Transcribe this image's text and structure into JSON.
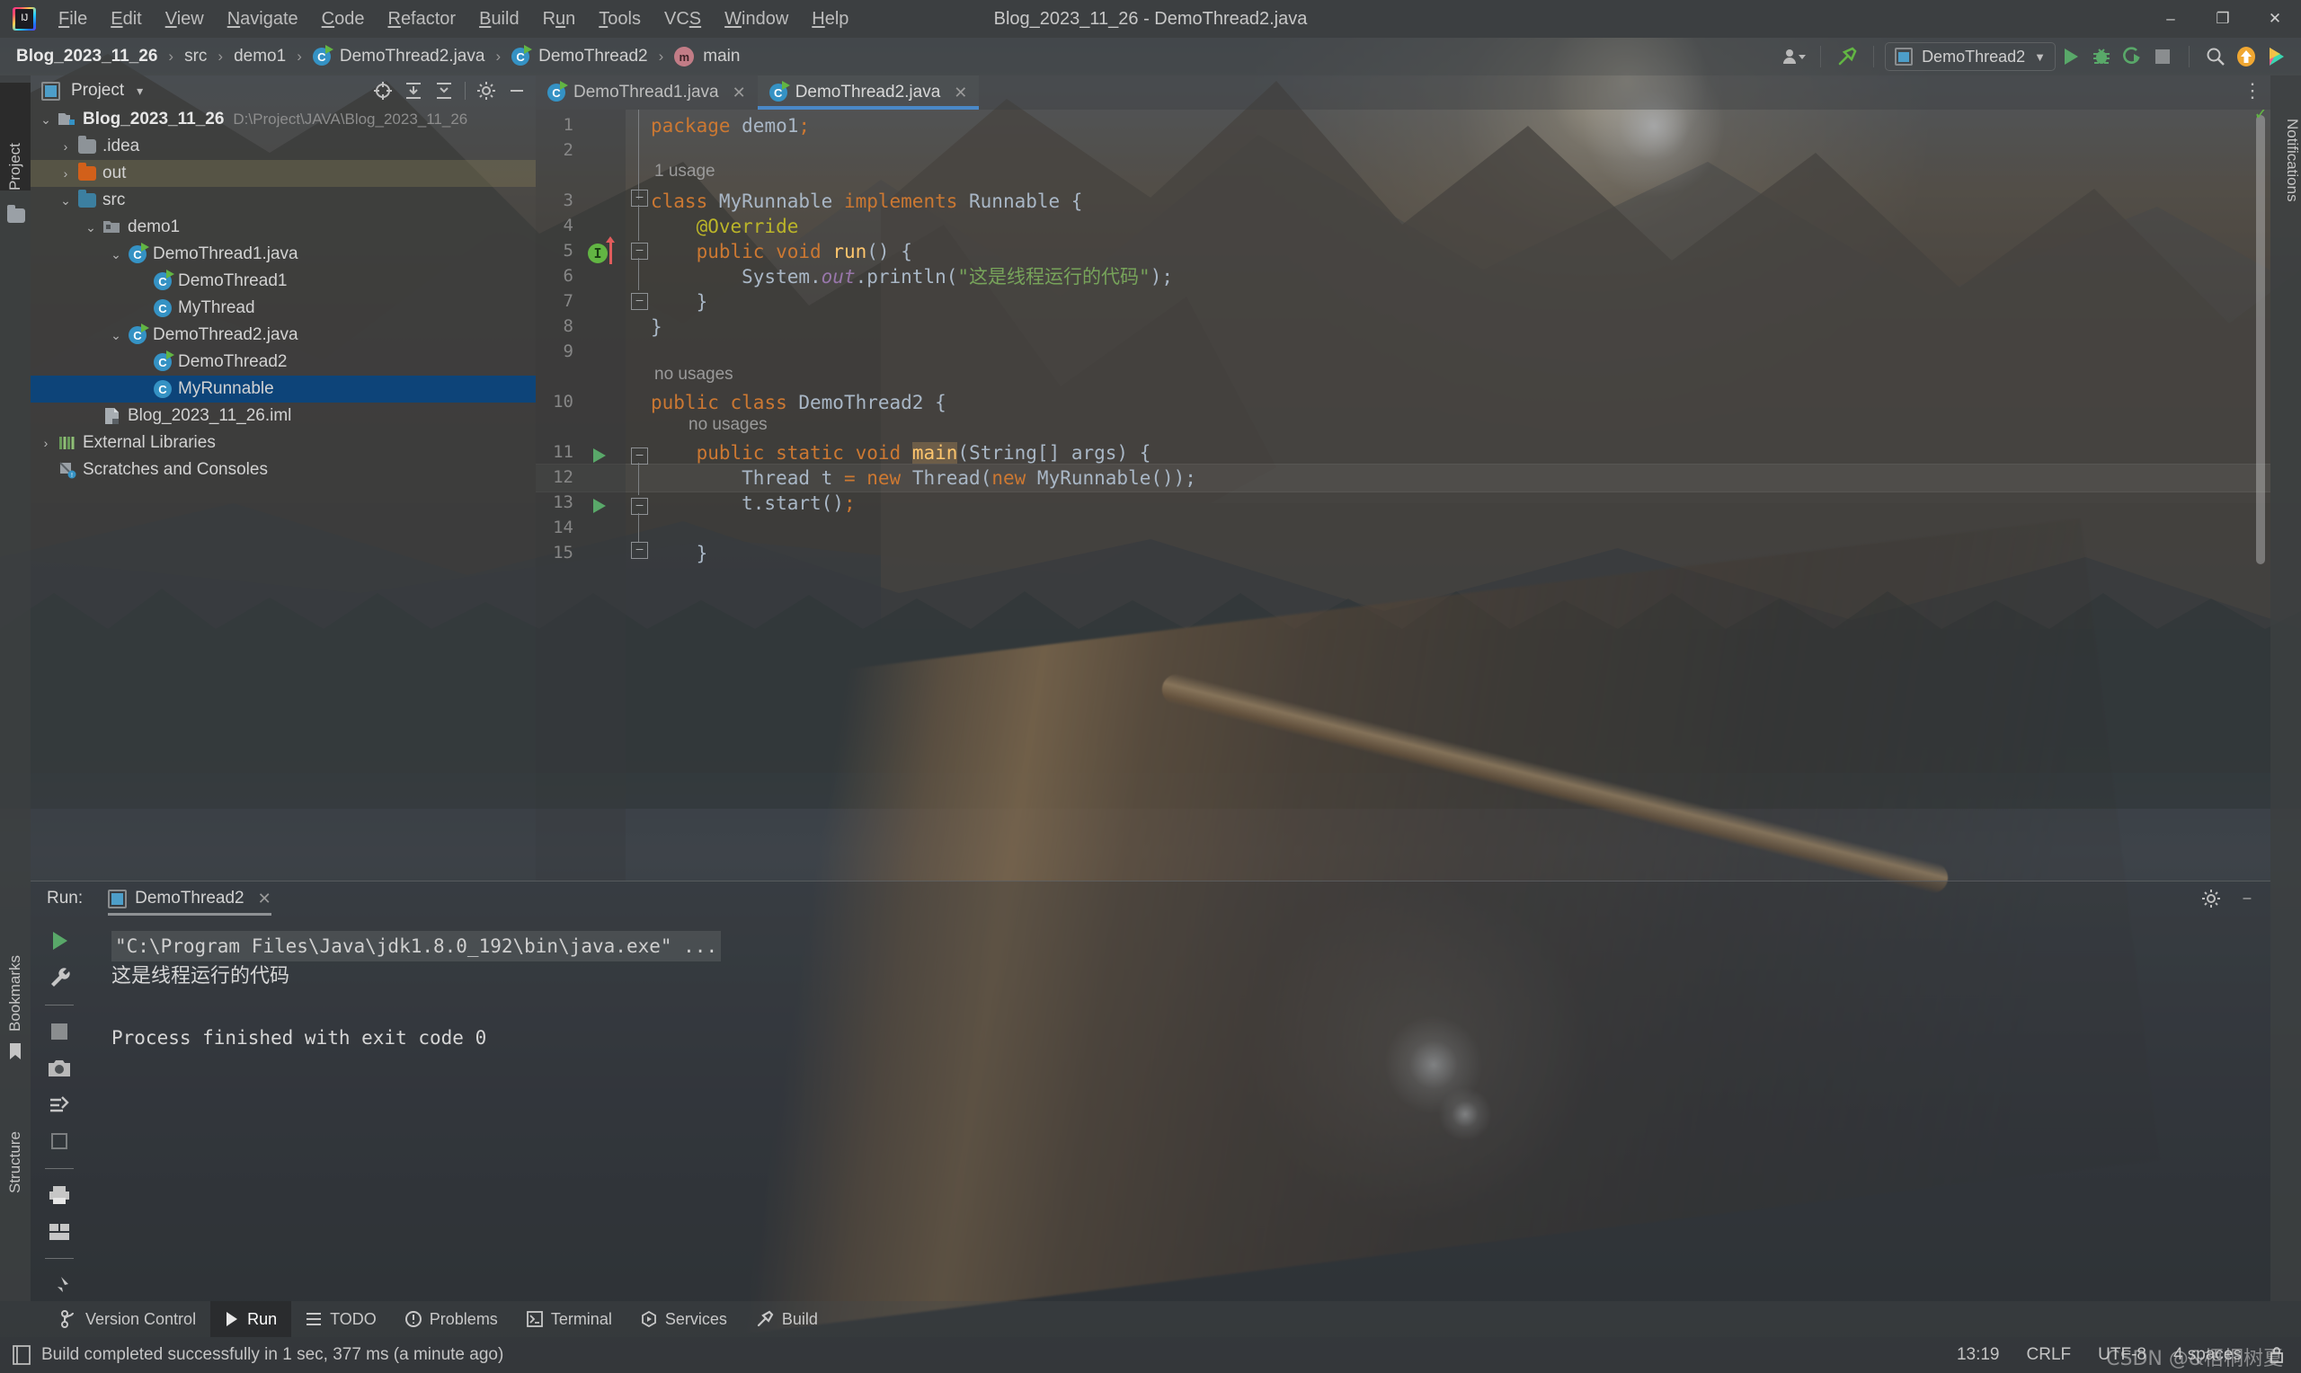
{
  "window": {
    "title": "Blog_2023_11_26 - DemoThread2.java",
    "minimize": "–",
    "maximize": "❐",
    "close": "✕"
  },
  "menu": {
    "items": [
      "File",
      "Edit",
      "View",
      "Navigate",
      "Code",
      "Refactor",
      "Build",
      "Run",
      "Tools",
      "VCS",
      "Window",
      "Help"
    ]
  },
  "navbar": {
    "crumbs": [
      {
        "label": "Blog_2023_11_26",
        "icon": ""
      },
      {
        "label": "src",
        "icon": ""
      },
      {
        "label": "demo1",
        "icon": ""
      },
      {
        "label": "DemoThread2.java",
        "icon": "java-class-icon"
      },
      {
        "label": "DemoThread2",
        "icon": "java-class-icon"
      },
      {
        "label": "main",
        "icon": "method-icon"
      }
    ],
    "separator": "›",
    "run_configuration": "DemoThread2",
    "dropdown_caret": "▼"
  },
  "toolwindows": {
    "left_tabs": [
      "Project",
      "Bookmarks",
      "Structure"
    ],
    "right_tabs": [
      "Notifications"
    ]
  },
  "project_panel": {
    "title": "Project",
    "caret": "▾",
    "tree": [
      {
        "label": "Blog_2023_11_26",
        "path": "D:\\Project\\JAVA\\Blog_2023_11_26",
        "indent": 0,
        "chevron": "⌄",
        "icon": "project-folder-icon",
        "bold": true,
        "state": "normal"
      },
      {
        "label": ".idea",
        "path": "",
        "indent": 1,
        "chevron": "›",
        "icon": "folder-grey-icon",
        "bold": false,
        "state": "normal"
      },
      {
        "label": "out",
        "path": "",
        "indent": 1,
        "chevron": "›",
        "icon": "folder-orange-icon",
        "bold": false,
        "state": "highlight"
      },
      {
        "label": "src",
        "path": "",
        "indent": 1,
        "chevron": "⌄",
        "icon": "folder-blue-icon",
        "bold": false,
        "state": "normal"
      },
      {
        "label": "demo1",
        "path": "",
        "indent": 2,
        "chevron": "⌄",
        "icon": "package-icon",
        "bold": false,
        "state": "normal"
      },
      {
        "label": "DemoThread1.java",
        "path": "",
        "indent": 3,
        "chevron": "⌄",
        "icon": "java-runnable-class-icon",
        "bold": false,
        "state": "normal"
      },
      {
        "label": "DemoThread1",
        "path": "",
        "indent": 4,
        "chevron": "",
        "icon": "java-runnable-class-icon",
        "bold": false,
        "state": "normal"
      },
      {
        "label": "MyThread",
        "path": "",
        "indent": 4,
        "chevron": "",
        "icon": "java-class-icon",
        "bold": false,
        "state": "normal"
      },
      {
        "label": "DemoThread2.java",
        "path": "",
        "indent": 3,
        "chevron": "⌄",
        "icon": "java-runnable-class-icon",
        "bold": false,
        "state": "normal"
      },
      {
        "label": "DemoThread2",
        "path": "",
        "indent": 4,
        "chevron": "",
        "icon": "java-runnable-class-icon",
        "bold": false,
        "state": "normal"
      },
      {
        "label": "MyRunnable",
        "path": "",
        "indent": 4,
        "chevron": "",
        "icon": "java-class-icon",
        "bold": false,
        "state": "selected"
      },
      {
        "label": "Blog_2023_11_26.iml",
        "path": "",
        "indent": 2,
        "chevron": "",
        "icon": "iml-file-icon",
        "bold": false,
        "state": "normal"
      },
      {
        "label": "External Libraries",
        "path": "",
        "indent": 0,
        "chevron": "›",
        "icon": "libraries-icon",
        "bold": false,
        "state": "normal"
      },
      {
        "label": "Scratches and Consoles",
        "path": "",
        "indent": 0,
        "chevron": "",
        "icon": "scratches-icon",
        "bold": false,
        "state": "normal"
      }
    ]
  },
  "editor": {
    "tabs": [
      {
        "label": "DemoThread1.java",
        "active": false,
        "close": "✕"
      },
      {
        "label": "DemoThread2.java",
        "active": true,
        "close": "✕"
      }
    ],
    "line_numbers": [
      "1",
      "2",
      "3",
      "4",
      "5",
      "6",
      "7",
      "8",
      "9",
      "10",
      "11",
      "12",
      "13",
      "14",
      "15"
    ],
    "hints": [
      {
        "text": "1 usage",
        "line": 3
      },
      {
        "text": "no usages",
        "line": 10
      },
      {
        "text": "no usages",
        "line": 11
      }
    ],
    "lines": [
      {
        "n": 1,
        "tokens": [
          {
            "t": "package",
            "c": "kw"
          },
          {
            "t": " demo1",
            "c": "cls"
          },
          {
            "t": ";",
            "c": "sem"
          }
        ]
      },
      {
        "n": 2,
        "tokens": []
      },
      {
        "n": 3,
        "tokens": [
          {
            "t": "class",
            "c": "kw"
          },
          {
            "t": " MyRunnable ",
            "c": "cls"
          },
          {
            "t": "implements",
            "c": "kw"
          },
          {
            "t": " Runnable {",
            "c": "cls"
          }
        ]
      },
      {
        "n": 4,
        "tokens": [
          {
            "t": "    @Override",
            "c": "anno"
          }
        ]
      },
      {
        "n": 5,
        "tokens": [
          {
            "t": "    ",
            "c": "txt"
          },
          {
            "t": "public",
            "c": "kw"
          },
          {
            "t": " ",
            "c": "txt"
          },
          {
            "t": "void",
            "c": "kw"
          },
          {
            "t": " ",
            "c": "txt"
          },
          {
            "t": "run",
            "c": "mth"
          },
          {
            "t": "() {",
            "c": "cls"
          }
        ]
      },
      {
        "n": 6,
        "tokens": [
          {
            "t": "        System.",
            "c": "cls"
          },
          {
            "t": "out",
            "c": "fld"
          },
          {
            "t": ".println(",
            "c": "cls"
          },
          {
            "t": "\"这是线程运行的代码\"",
            "c": "str"
          },
          {
            "t": ");",
            "c": "cls"
          }
        ]
      },
      {
        "n": 7,
        "tokens": [
          {
            "t": "    }",
            "c": "cls"
          }
        ]
      },
      {
        "n": 8,
        "tokens": [
          {
            "t": "}",
            "c": "cls"
          }
        ]
      },
      {
        "n": 9,
        "tokens": []
      },
      {
        "n": 10,
        "tokens": [
          {
            "t": "public",
            "c": "kw"
          },
          {
            "t": " ",
            "c": "txt"
          },
          {
            "t": "class",
            "c": "kw"
          },
          {
            "t": " DemoThread2 {",
            "c": "cls"
          }
        ]
      },
      {
        "n": 11,
        "tokens": [
          {
            "t": "    ",
            "c": "txt"
          },
          {
            "t": "public",
            "c": "kw"
          },
          {
            "t": " ",
            "c": "txt"
          },
          {
            "t": "static",
            "c": "kw"
          },
          {
            "t": " ",
            "c": "txt"
          },
          {
            "t": "void",
            "c": "kw"
          },
          {
            "t": " ",
            "c": "txt"
          },
          {
            "t": "main",
            "c": "mainhl"
          },
          {
            "t": "(String[] args) {",
            "c": "cls"
          }
        ]
      },
      {
        "n": 12,
        "tokens": [
          {
            "t": "        Thread t ",
            "c": "cls"
          },
          {
            "t": "=",
            "c": "sem"
          },
          {
            "t": " ",
            "c": "txt"
          },
          {
            "t": "new",
            "c": "kw"
          },
          {
            "t": " Thread(",
            "c": "cls"
          },
          {
            "t": "new",
            "c": "kw"
          },
          {
            "t": " MyRunnable());",
            "c": "cls"
          }
        ]
      },
      {
        "n": 13,
        "tokens": [
          {
            "t": "        t.start()",
            "c": "cls"
          },
          {
            "t": ";",
            "c": "sem"
          }
        ]
      },
      {
        "n": 14,
        "tokens": []
      },
      {
        "n": 15,
        "tokens": [
          {
            "t": "    }",
            "c": "cls"
          }
        ]
      }
    ],
    "caret_line": 13,
    "inspection_status": "✓"
  },
  "run_window": {
    "label": "Run:",
    "tab": "DemoThread2",
    "tab_close": "✕",
    "settings_icon": "gear-icon",
    "minimize_icon": "–",
    "tool_icons": [
      "rerun-icon",
      "wrench-icon",
      "stop-icon",
      "camera-icon",
      "thread-dump-icon",
      "restore-layout-icon",
      "print-icon",
      "soft-wrap-icon",
      "pin-icon"
    ],
    "console": [
      {
        "text": "\"C:\\Program Files\\Java\\jdk1.8.0_192\\bin\\java.exe\" ...",
        "style": "cmd"
      },
      {
        "text": "这是线程运行的代码",
        "style": "zh"
      },
      {
        "text": "",
        "style": "plain"
      },
      {
        "text": "Process finished with exit code 0",
        "style": "plain"
      }
    ]
  },
  "bottom_bar": {
    "items": [
      {
        "label": "Version Control",
        "icon": "branch-icon",
        "active": false
      },
      {
        "label": "Run",
        "icon": "play-icon",
        "active": true
      },
      {
        "label": "TODO",
        "icon": "list-icon",
        "active": false
      },
      {
        "label": "Problems",
        "icon": "warning-icon",
        "active": false
      },
      {
        "label": "Terminal",
        "icon": "terminal-icon",
        "active": false
      },
      {
        "label": "Services",
        "icon": "services-icon",
        "active": false
      },
      {
        "label": "Build",
        "icon": "hammer-icon",
        "active": false
      }
    ]
  },
  "status_bar": {
    "message": "Build completed successfully in 1 sec, 377 ms (a minute ago)",
    "message_icon": "build-icon",
    "time": "13:19",
    "line_separator": "CRLF",
    "encoding": "UTF-8",
    "indent": "4 spaces",
    "lock_icon": "lock-icon",
    "watermark": "CSDN @&梧桐树夏"
  },
  "colors": {
    "accent_blue": "#4a88c7",
    "selection_blue": "#0d4479",
    "green_run": "#59a869",
    "orange_keyword": "#cc7832",
    "string_green": "#77a35a",
    "class_blue": "#a9b7c6",
    "annotation_yellow": "#bbb529",
    "method_yellow": "#ffc66d",
    "chrome_grey": "#3c3f41"
  }
}
